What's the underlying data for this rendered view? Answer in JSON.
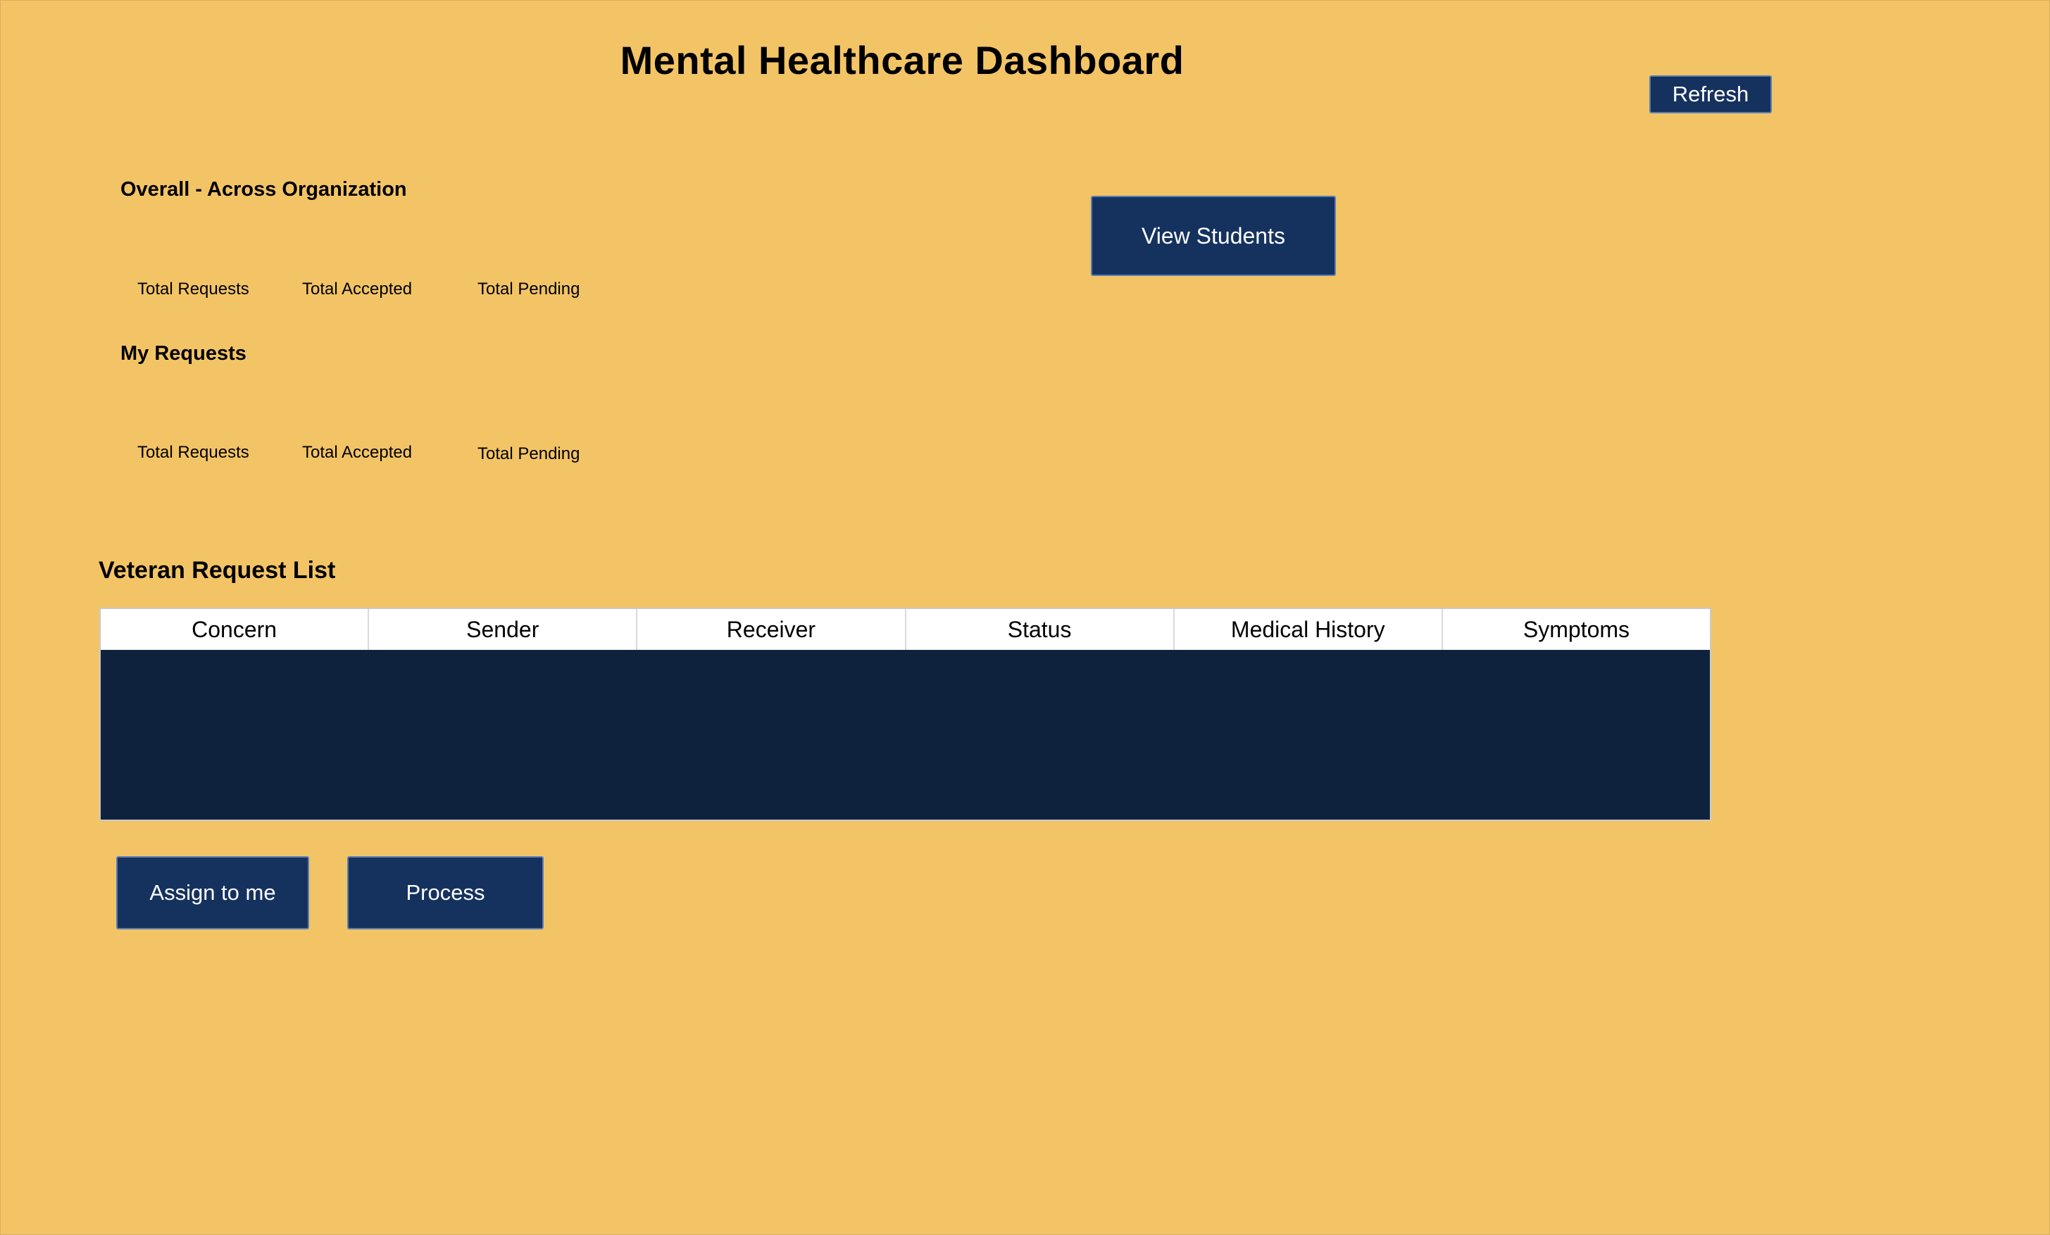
{
  "header": {
    "title": "Mental Healthcare Dashboard",
    "refresh_label": "Refresh"
  },
  "overall": {
    "heading": "Overall - Across Organization",
    "total_requests_label": "Total Requests",
    "total_accepted_label": "Total Accepted",
    "total_pending_label": "Total Pending"
  },
  "my_requests": {
    "heading": "My Requests",
    "total_requests_label": "Total Requests",
    "total_accepted_label": "Total Accepted",
    "total_pending_label": "Total Pending"
  },
  "actions": {
    "view_students_label": "View Students",
    "assign_label": "Assign to me",
    "process_label": "Process"
  },
  "request_list": {
    "heading": "Veteran Request List",
    "columns": [
      "Concern",
      "Sender",
      "Receiver",
      "Status",
      "Medical History",
      "Symptoms"
    ],
    "rows": []
  },
  "colors": {
    "background": "#F3C466",
    "button": "#15325F",
    "table_body": "#0E223D"
  }
}
